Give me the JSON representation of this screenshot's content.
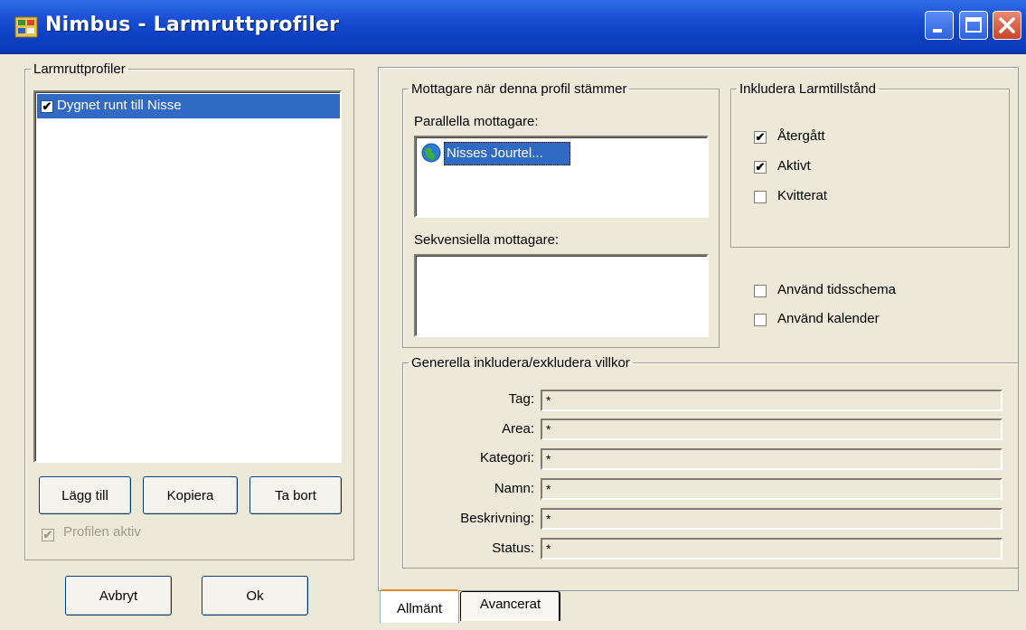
{
  "window": {
    "title": "Nimbus - Larmruttprofiler",
    "controls": [
      "minimize",
      "maximize",
      "close"
    ]
  },
  "profiles": {
    "legend": "Larmruttprofiler",
    "items": [
      {
        "label": "Dygnet runt till Nisse",
        "checked": true,
        "selected": true
      }
    ],
    "add_label": "Lägg till",
    "copy_label": "Kopiera",
    "remove_label": "Ta bort",
    "active_label": "Profilen aktiv"
  },
  "recipients": {
    "legend": "Mottagare när denna profil stämmer",
    "parallel_label": "Parallella mottagare:",
    "parallel_items": [
      {
        "label": "Nisses Jourtel...",
        "icon": "globe-icon"
      }
    ],
    "sequential_label": "Sekvensiella mottagare:"
  },
  "alarm_states": {
    "legend": "Inkludera Larmtillstånd",
    "items": [
      {
        "label": "Återgått",
        "checked": true
      },
      {
        "label": "Aktivt",
        "checked": true
      },
      {
        "label": "Kvitterat",
        "checked": false
      }
    ]
  },
  "options": {
    "use_schedule": "Använd tidsschema",
    "use_calendar": "Använd kalender"
  },
  "conditions": {
    "legend": "Generella inkludera/exkludera villkor",
    "rows": [
      {
        "label": "Tag:",
        "value": "*"
      },
      {
        "label": "Area:",
        "value": "*"
      },
      {
        "label": "Kategori:",
        "value": "*"
      },
      {
        "label": "Namn:",
        "value": "*"
      },
      {
        "label": "Beskrivning:",
        "value": "*"
      },
      {
        "label": "Status:",
        "value": "*"
      }
    ]
  },
  "footer": {
    "cancel_label": "Avbryt",
    "ok_label": "Ok"
  },
  "tabs": [
    "Allmänt",
    "Avancerat"
  ],
  "colors": {
    "titlebar": "#1a4fd4",
    "selection": "#316ac5",
    "face": "#ece9d8"
  }
}
